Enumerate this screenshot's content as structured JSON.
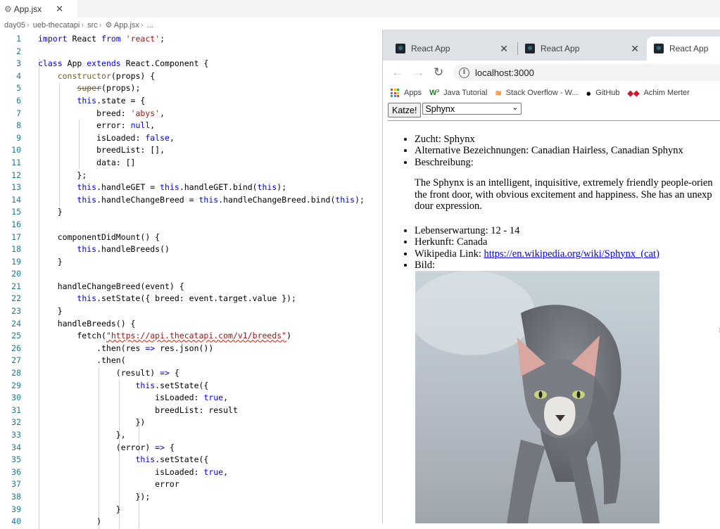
{
  "editor": {
    "tab_label": "App.jsx",
    "breadcrumb": [
      "day05",
      "ueb-thecatapi",
      "src",
      "App.jsx",
      "..."
    ],
    "lines": [
      {
        "n": "1",
        "html": "<span class=\"kw\">import</span> React <span class=\"kw\">from</span> <span class=\"str\">'react'</span>;"
      },
      {
        "n": "2",
        "html": ""
      },
      {
        "n": "3",
        "html": "<span class=\"kw\">class</span> App <span class=\"kw\">extends</span> React.Component {"
      },
      {
        "n": "4",
        "html": "    <span class=\"fn\">constructor</span>(props) {"
      },
      {
        "n": "5",
        "html": "        <span class=\"strike\">super</span>(props);"
      },
      {
        "n": "6",
        "html": "        <span class=\"kw\">this</span>.state = {"
      },
      {
        "n": "7",
        "html": "            breed: <span class=\"str\">'abys'</span>,"
      },
      {
        "n": "8",
        "html": "            error: <span class=\"kw\">null</span>,"
      },
      {
        "n": "9",
        "html": "            isLoaded: <span class=\"kw\">false</span>,"
      },
      {
        "n": "10",
        "html": "            breedList: [],"
      },
      {
        "n": "11",
        "html": "            data: []"
      },
      {
        "n": "12",
        "html": "        };"
      },
      {
        "n": "13",
        "html": "        <span class=\"kw\">this</span>.handleGET = <span class=\"kw\">this</span>.handleGET.bind(<span class=\"kw\">this</span>);"
      },
      {
        "n": "14",
        "html": "        <span class=\"kw\">this</span>.handleChangeBreed = <span class=\"kw\">this</span>.handleChangeBreed.bind(<span class=\"kw\">this</span>);"
      },
      {
        "n": "15",
        "html": "    }"
      },
      {
        "n": "16",
        "html": ""
      },
      {
        "n": "17",
        "html": "    componentDidMount() {"
      },
      {
        "n": "18",
        "html": "        <span class=\"kw\">this</span>.handleBreeds()"
      },
      {
        "n": "19",
        "html": "    }"
      },
      {
        "n": "20",
        "html": ""
      },
      {
        "n": "21",
        "html": "    handleChangeBreed(event) {"
      },
      {
        "n": "22",
        "html": "        <span class=\"kw\">this</span>.setState({ breed: event.target.value });"
      },
      {
        "n": "23",
        "html": "    }"
      },
      {
        "n": "24",
        "html": "    handleBreeds() {"
      },
      {
        "n": "25",
        "html": "        fetch(<span class=\"str squig\">\"https://api.thecatapi.com/v1/breeds\"</span>)"
      },
      {
        "n": "26",
        "html": "            .then(res <span class=\"kw\">=&gt;</span> res.json())"
      },
      {
        "n": "27",
        "html": "            .then("
      },
      {
        "n": "28",
        "html": "                (result) <span class=\"kw\">=&gt;</span> {"
      },
      {
        "n": "29",
        "html": "                    <span class=\"kw\">this</span>.setState({"
      },
      {
        "n": "30",
        "html": "                        isLoaded: <span class=\"kw\">true</span>,"
      },
      {
        "n": "31",
        "html": "                        breedList: result"
      },
      {
        "n": "32",
        "html": "                    })"
      },
      {
        "n": "33",
        "html": "                },"
      },
      {
        "n": "34",
        "html": "                (error) <span class=\"kw\">=&gt;</span> {"
      },
      {
        "n": "35",
        "html": "                    <span class=\"kw\">this</span>.setState({"
      },
      {
        "n": "36",
        "html": "                        isLoaded: <span class=\"kw\">true</span>,"
      },
      {
        "n": "37",
        "html": "                        error"
      },
      {
        "n": "38",
        "html": "                    });"
      },
      {
        "n": "39",
        "html": "                }"
      },
      {
        "n": "40",
        "html": "            )"
      }
    ]
  },
  "browser": {
    "tabs": [
      "React App",
      "React App",
      "React App"
    ],
    "address": "localhost:3000",
    "bookmarks": [
      "Apps",
      "Java Tutorial",
      "Stack Overflow - W...",
      "GitHub",
      "Achim Merter"
    ],
    "page": {
      "button_label": "Katze!",
      "selected_breed": "Sphynx",
      "items_top": [
        "Zucht: Sphynx",
        "Alternative Bezeichnungen: Canadian Hairless, Canadian Sphynx",
        "Beschreibung:"
      ],
      "description_lines": [
        "The Sphynx is an intelligent, inquisitive, extremely friendly people-orien",
        "the front door, with obvious excitement and happiness. She has an unexp",
        "dour expression."
      ],
      "items_bottom": [
        "Lebenserwartung: 12 - 14",
        "Herkunft: Canada"
      ],
      "wiki_label": "Wikipedia Link: ",
      "wiki_url": "https://en.wikipedia.org/wiki/Sphynx_(cat)",
      "image_label": "Bild:"
    }
  }
}
